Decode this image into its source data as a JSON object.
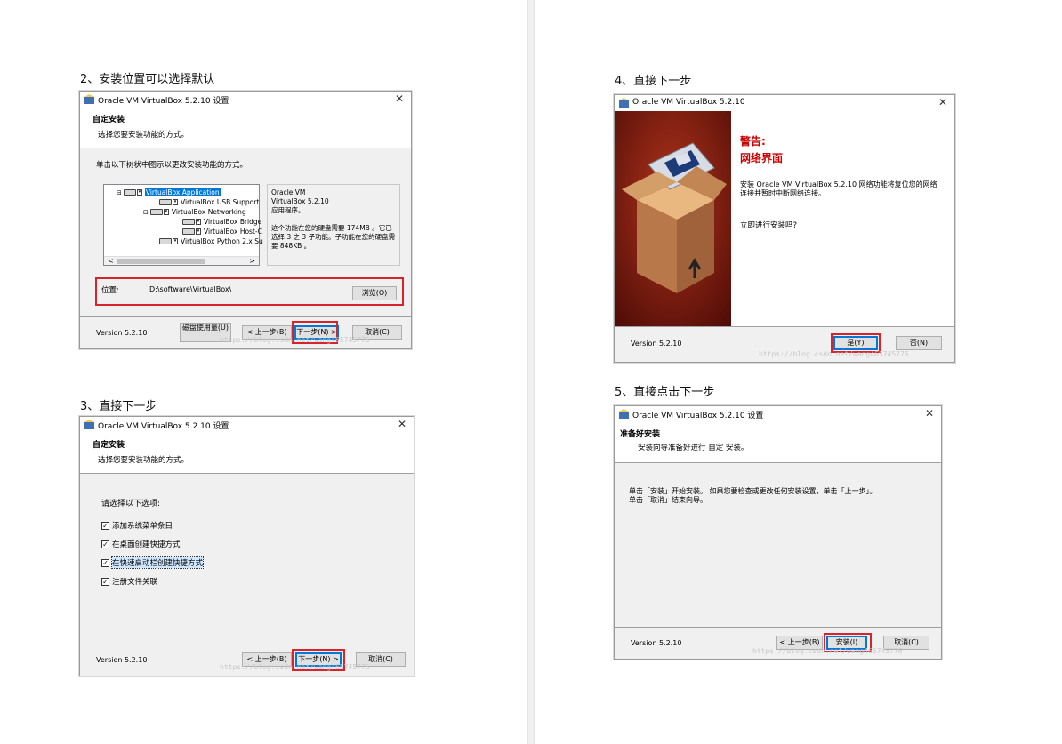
{
  "left_column": {
    "step2": {
      "title": "2、安装位置可以选择默认",
      "window_title": "Oracle VM VirtualBox 5.2.10 设置",
      "header_title": "自定安装",
      "header_subtitle": "选择您要安装功能的方式。",
      "instruction": "单击以下树状中图示以更改安装功能的方式。",
      "tree_items": [
        "VirtualBox Application",
        "VirtualBox USB Support",
        "VirtualBox Networking",
        "VirtualBox Bridge",
        "VirtualBox Host-C",
        "VirtualBox Python 2.x Su"
      ],
      "desc_line1": "Oracle VM VirtualBox 5.2.10 应用程序。",
      "desc_line2": "这个功能在您的硬盘需要 174MB 。它已选择 3 之 3 子功能。子功能在您的硬盘需要 848KB 。",
      "location_label": "位置:",
      "location_value": "D:\\software\\VirtualBox\\",
      "browse": "浏览(O)",
      "version": "Version 5.2.10",
      "disk_usage": "磁盘使用量(U)",
      "back": "< 上一步(B)",
      "next": "下一步(N) >",
      "cancel": "取消(C)",
      "watermark": "https://blog.csdn.net/wang465745776"
    },
    "step3": {
      "title": "3、直接下一步",
      "window_title": "Oracle VM VirtualBox 5.2.10 设置",
      "header_title": "自定安装",
      "header_subtitle": "选择您要安装功能的方式。",
      "prompt": "请选择以下选项:",
      "options": [
        "添加系统菜单条目",
        "在桌面创建快捷方式",
        "在快速启动栏创建快捷方式",
        "注册文件关联"
      ],
      "version": "Version 5.2.10",
      "back": "< 上一步(B)",
      "next": "下一步(N) >",
      "cancel": "取消(C)",
      "watermark": "https://blog.csdn.net/wang465745776"
    }
  },
  "right_column": {
    "step4": {
      "title": "4、直接下一步",
      "window_title": "Oracle VM VirtualBox 5.2.10",
      "warning": "警告:",
      "warning_sub": "网络界面",
      "message": "安装 Oracle VM VirtualBox 5.2.10 网络功能将复位您的网络连接并暂时中断网络连接。",
      "question": "立即进行安装吗?",
      "version": "Version 5.2.10",
      "yes": "是(Y)",
      "no": "否(N)",
      "watermark": "https://blog.csdn.net/wang465745776"
    },
    "step5": {
      "title": "5、直接点击下一步",
      "window_title": "Oracle VM VirtualBox 5.2.10 设置",
      "header_title": "准备好安装",
      "header_subtitle": "安装向导准备好进行 自定 安装。",
      "line1": "单击「安装」开始安装。 如果您要检查或更改任何安装设置，单击「上一步」。",
      "line2": "单击「取消」结束向导。",
      "version": "Version 5.2.10",
      "back": "< 上一步(B)",
      "install": "安装(I)",
      "cancel": "取消(C)",
      "watermark": "https://blog.csdn.net/wang465745776"
    }
  },
  "colors": {
    "highlight_red": "#d9232a",
    "selection_blue": "#0078d7",
    "warning_red": "#cc0000"
  }
}
